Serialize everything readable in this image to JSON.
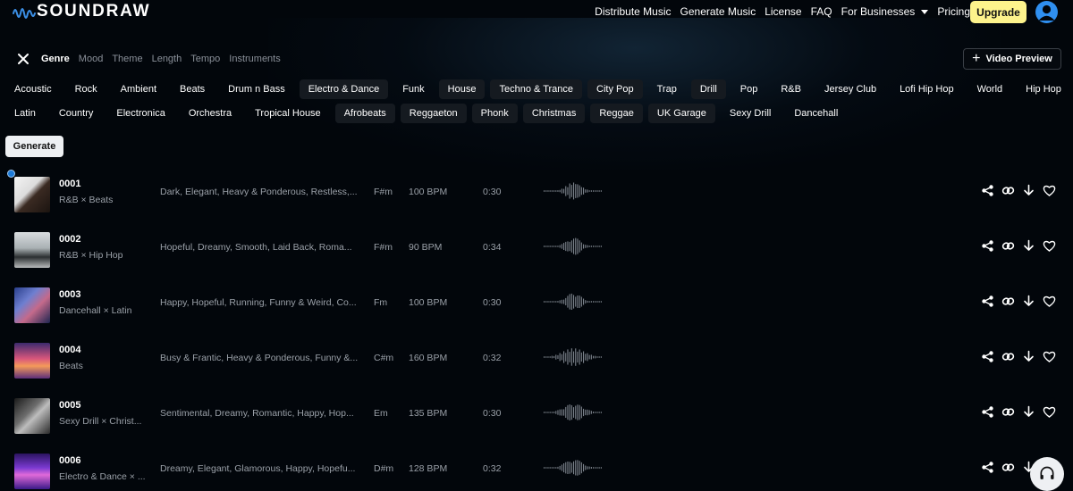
{
  "brand": {
    "name": "SOUNDRAW"
  },
  "nav": {
    "items": [
      "Distribute Music",
      "Generate Music",
      "License",
      "FAQ",
      "For Businesses",
      "Pricing"
    ],
    "upgrade_label": "Upgrade"
  },
  "filters": {
    "tabs": [
      "Genre",
      "Mood",
      "Theme",
      "Length",
      "Tempo",
      "Instruments"
    ],
    "active_tab": "Genre",
    "video_preview_label": "Video Preview"
  },
  "genres_row1": [
    "Acoustic",
    "Rock",
    "Ambient",
    "Beats",
    "Drum n Bass",
    "Electro & Dance",
    "Funk",
    "House",
    "Techno & Trance",
    "City Pop",
    "Trap",
    "Drill",
    "Pop",
    "R&B",
    "Jersey Club",
    "Lofi Hip Hop",
    "World",
    "Hip Hop"
  ],
  "genres_row2": [
    "Latin",
    "Country",
    "Electronica",
    "Orchestra",
    "Tropical House",
    "Afrobeats",
    "Reggaeton",
    "Phonk",
    "Christmas",
    "Reggae",
    "UK Garage",
    "Sexy Drill",
    "Dancehall"
  ],
  "generate_label": "Generate",
  "tracks": [
    {
      "number": "0001",
      "genre": "R&B × Beats",
      "moods": "Dark, Elegant, Heavy & Ponderous, Restless,...",
      "key": "F#m",
      "bpm": "100 BPM",
      "length": "0:30"
    },
    {
      "number": "0002",
      "genre": "R&B × Hip Hop",
      "moods": "Hopeful, Dreamy, Smooth, Laid Back, Roma...",
      "key": "F#m",
      "bpm": "90 BPM",
      "length": "0:34"
    },
    {
      "number": "0003",
      "genre": "Dancehall × Latin",
      "moods": "Happy, Hopeful, Running, Funny & Weird, Co...",
      "key": "Fm",
      "bpm": "100 BPM",
      "length": "0:30"
    },
    {
      "number": "0004",
      "genre": "Beats",
      "moods": "Busy & Frantic, Heavy & Ponderous, Funny &...",
      "key": "C#m",
      "bpm": "160 BPM",
      "length": "0:32"
    },
    {
      "number": "0005",
      "genre": "Sexy Drill × Christ...",
      "moods": "Sentimental, Dreamy, Romantic, Happy, Hop...",
      "key": "Em",
      "bpm": "135 BPM",
      "length": "0:30"
    },
    {
      "number": "0006",
      "genre": "Electro & Dance × ...",
      "moods": "Dreamy, Elegant, Glamorous, Happy, Hopefu...",
      "key": "D#m",
      "bpm": "128 BPM",
      "length": "0:32"
    }
  ],
  "icons": {
    "track_actions": [
      "share-icon",
      "link-icon",
      "download-icon",
      "heart-icon"
    ],
    "support": "headset-icon"
  },
  "colors": {
    "background": "#02060b",
    "upgrade": "#fdf38c",
    "avatar": "#2f8ff0",
    "logo_wave": "#3b8fe6",
    "chip_bg": "#151a20",
    "muted_text": "#9aa0a8"
  }
}
